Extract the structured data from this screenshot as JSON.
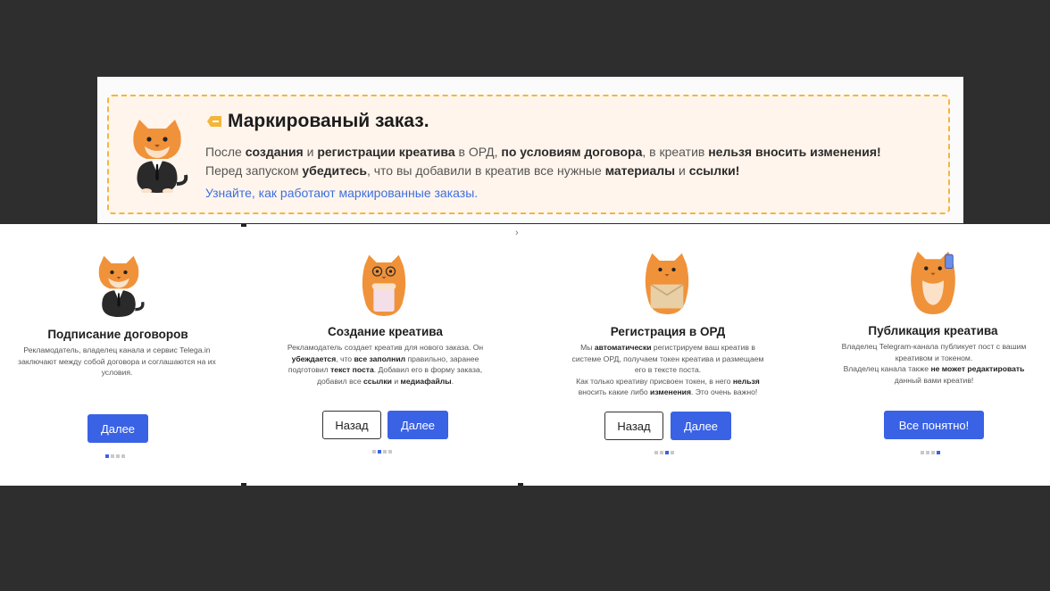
{
  "notice": {
    "title": "Маркированый заказ.",
    "line1": [
      {
        "t": "После ",
        "b": false
      },
      {
        "t": "создания",
        "b": true
      },
      {
        "t": " и ",
        "b": false
      },
      {
        "t": "регистрации креатива",
        "b": true
      },
      {
        "t": " в ОРД, ",
        "b": false
      },
      {
        "t": "по условиям договора",
        "b": true
      },
      {
        "t": ", в креатив ",
        "b": false
      },
      {
        "t": "нельзя вносить изменения!",
        "b": true
      }
    ],
    "line2": [
      {
        "t": "Перед запуском ",
        "b": false
      },
      {
        "t": "убедитесь",
        "b": true
      },
      {
        "t": ", что вы добавили в креатив все нужные ",
        "b": false
      },
      {
        "t": "материалы",
        "b": true
      },
      {
        "t": " и ",
        "b": false
      },
      {
        "t": "ссылки!",
        "b": true
      }
    ],
    "link": "Узнайте, как работают маркированные заказы."
  },
  "steps": [
    {
      "title": "Подписание договоров",
      "desc": [
        [
          {
            "t": "Рекламодатель, владелец канала и сервис Telega.in",
            "b": false
          }
        ],
        [
          {
            "t": "заключают между собой договора и соглашаются на их",
            "b": false
          }
        ],
        [
          {
            "t": "условия.",
            "b": false
          }
        ]
      ],
      "next_label": "Далее",
      "back_label": null,
      "active_dot": 0
    },
    {
      "title": "Создание креатива",
      "desc": [
        [
          {
            "t": "Рекламодатель создает креатив для нового заказа. Он",
            "b": false
          }
        ],
        [
          {
            "t": "убеждается",
            "b": true
          },
          {
            "t": ", что ",
            "b": false
          },
          {
            "t": "все заполнил",
            "b": true
          },
          {
            "t": " правильно, заранее",
            "b": false
          }
        ],
        [
          {
            "t": "подготовил ",
            "b": false
          },
          {
            "t": "текст поста",
            "b": true
          },
          {
            "t": ". Добавил его в форму заказа,",
            "b": false
          }
        ],
        [
          {
            "t": "добавил все ",
            "b": false
          },
          {
            "t": "ссылки",
            "b": true
          },
          {
            "t": " и ",
            "b": false
          },
          {
            "t": "медиафайлы",
            "b": true
          },
          {
            "t": ".",
            "b": false
          }
        ]
      ],
      "next_label": "Далее",
      "back_label": "Назад",
      "active_dot": 1
    },
    {
      "title": "Регистрация в ОРД",
      "desc": [
        [
          {
            "t": "Мы ",
            "b": false
          },
          {
            "t": "автоматически",
            "b": true
          },
          {
            "t": " регистрируем ваш креатив в",
            "b": false
          }
        ],
        [
          {
            "t": "системе ОРД, получаем токен креатива и размещаем",
            "b": false
          }
        ],
        [
          {
            "t": "его в тексте поста.",
            "b": false
          }
        ],
        [
          {
            "t": "Как только креативу присвоен токен, в него ",
            "b": false
          },
          {
            "t": "нельзя",
            "b": true
          }
        ],
        [
          {
            "t": "вносить какие либо ",
            "b": false
          },
          {
            "t": "изменения",
            "b": true
          },
          {
            "t": ". Это очень важно!",
            "b": false
          }
        ]
      ],
      "next_label": "Далее",
      "back_label": "Назад",
      "active_dot": 2
    },
    {
      "title": "Публикация креатива",
      "desc": [
        [
          {
            "t": "Владелец Telegram-канала публикует пост с вашим",
            "b": false
          }
        ],
        [
          {
            "t": "креативом и токеном.",
            "b": false
          }
        ],
        [
          {
            "t": "Владелец канала также ",
            "b": false
          },
          {
            "t": "не может редактировать",
            "b": true
          }
        ],
        [
          {
            "t": "данный вами креатив!",
            "b": false
          }
        ]
      ],
      "next_label": "Все понятно!",
      "back_label": null,
      "active_dot": 3
    }
  ],
  "colors": {
    "accent": "#3a62e5",
    "notice_border": "#f3b63a",
    "notice_bg": "#fff5ec",
    "link": "#3d6fe0",
    "cat": "#f0923a"
  },
  "icons": [
    "tag-icon",
    "chevron-right-icon"
  ]
}
